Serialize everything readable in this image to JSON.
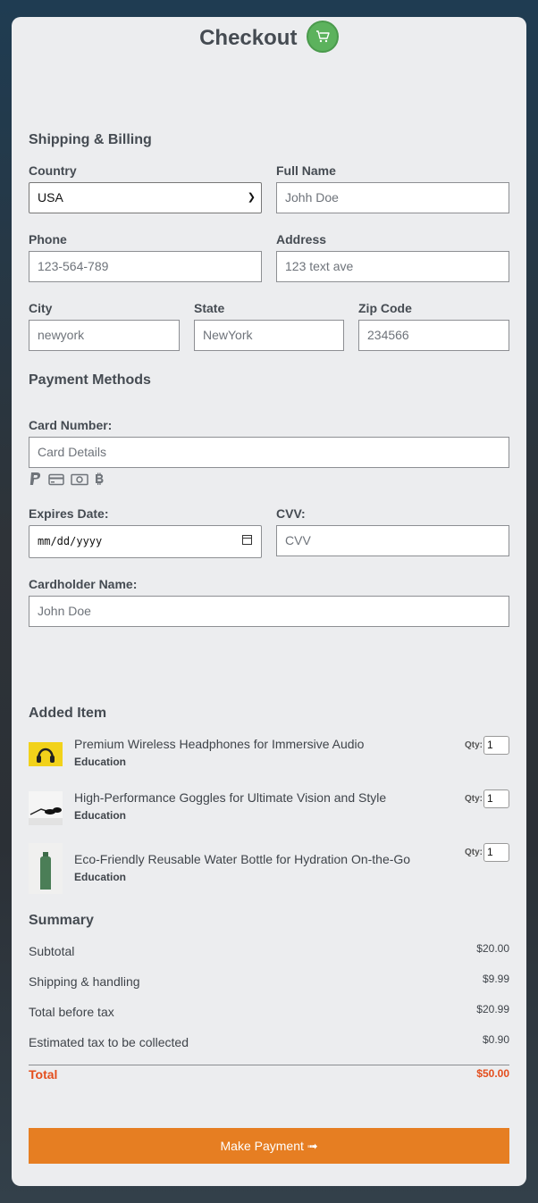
{
  "header": {
    "title": "Checkout",
    "cart_icon": "shopping-cart-icon",
    "cart_color": "#5cb25d"
  },
  "shipping": {
    "section_title": "Shipping & Billing",
    "country": {
      "label": "Country",
      "value": "USA"
    },
    "full_name": {
      "label": "Full Name",
      "value": "Johh Doe"
    },
    "phone": {
      "label": "Phone",
      "value": "123-564-789"
    },
    "address": {
      "label": "Address",
      "value": "123 text ave"
    },
    "city": {
      "label": "City",
      "value": "newyork"
    },
    "state": {
      "label": "State",
      "value": "NewYork"
    },
    "zip": {
      "label": "Zip Code",
      "value": "234566"
    }
  },
  "payment": {
    "section_title": "Payment Methods",
    "card_number": {
      "label": "Card Number:",
      "placeholder": "Card Details"
    },
    "icons": [
      "paypal-icon",
      "credit-card-icon",
      "money-bill-icon",
      "bitcoin-icon"
    ],
    "expires": {
      "label": "Expires Date:",
      "placeholder": "mm/dd/yyyy"
    },
    "cvv": {
      "label": "CVV:",
      "placeholder": "CVV"
    },
    "cardholder": {
      "label": "Cardholder Name:",
      "placeholder": "John Doe"
    }
  },
  "items": {
    "section_title": "Added Item",
    "qty_label": "Qty:",
    "list": [
      {
        "title": "Premium Wireless Headphones for Immersive Audio",
        "category": "Education",
        "qty": "1"
      },
      {
        "title": "High-Performance Goggles for Ultimate Vision and Style",
        "category": "Education",
        "qty": "1"
      },
      {
        "title": "Eco-Friendly Reusable Water Bottle for Hydration On-the-Go",
        "category": "Education",
        "qty": "1"
      }
    ]
  },
  "summary": {
    "section_title": "Summary",
    "subtotal": {
      "label": "Subtotal",
      "value": "$20.00"
    },
    "shipping": {
      "label": "Shipping & handling",
      "value": "$9.99"
    },
    "before_tax": {
      "label": "Total before tax",
      "value": "$20.99"
    },
    "tax": {
      "label": "Estimated tax to be collected",
      "value": "$0.90"
    },
    "total": {
      "label": "Total",
      "value": "$50.00"
    }
  },
  "action": {
    "pay_button": "Make Payment ➟",
    "button_color": "#e67e22"
  }
}
